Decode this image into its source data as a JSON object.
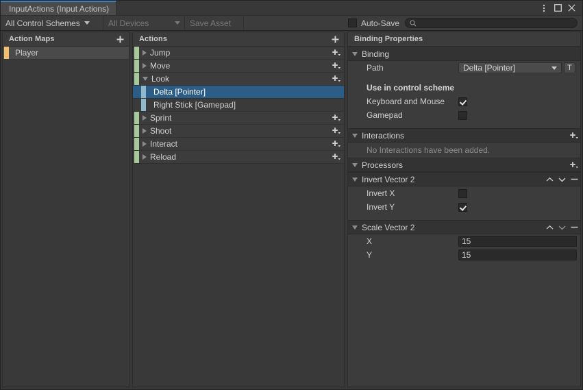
{
  "window": {
    "tab_title": "InputActions (Input Actions)",
    "menu_icon": "kebab-menu-icon",
    "maximize_icon": "maximize-icon",
    "close_icon": "close-icon",
    "accent_color": "#3f7fbe"
  },
  "toolbar": {
    "control_schemes_label": "All Control Schemes",
    "devices_label": "All Devices",
    "save_asset_label": "Save Asset",
    "autosave_label": "Auto-Save",
    "autosave_checked": false,
    "search_icon": "search-icon",
    "search_value": "",
    "search_placeholder": ""
  },
  "action_maps": {
    "header": "Action Maps",
    "add_icon": "plus-icon",
    "items": [
      {
        "label": "Player",
        "selected": true,
        "accent": "#f0c070"
      }
    ]
  },
  "actions": {
    "header": "Actions",
    "add_icon": "plus-icon",
    "accent_action": "#a7c99a",
    "accent_binding": "#8fb8cc",
    "selection_color": "#2c5d87",
    "rows": [
      {
        "type": "action",
        "label": "Jump",
        "expanded": false,
        "selected": false
      },
      {
        "type": "action",
        "label": "Move",
        "expanded": false,
        "selected": false
      },
      {
        "type": "action",
        "label": "Look",
        "expanded": true,
        "selected": false
      },
      {
        "type": "binding",
        "label": "Delta [Pointer]",
        "selected": true
      },
      {
        "type": "binding",
        "label": "Right Stick [Gamepad]",
        "selected": false
      },
      {
        "type": "action",
        "label": "Sprint",
        "expanded": false,
        "selected": false
      },
      {
        "type": "action",
        "label": "Shoot",
        "expanded": false,
        "selected": false
      },
      {
        "type": "action",
        "label": "Interact",
        "expanded": false,
        "selected": false
      },
      {
        "type": "action",
        "label": "Reload",
        "expanded": false,
        "selected": false
      }
    ]
  },
  "binding_properties": {
    "header": "Binding Properties",
    "binding_section": {
      "title": "Binding",
      "expanded": true,
      "path_label": "Path",
      "path_value": "Delta [Pointer]",
      "path_button_label": "T"
    },
    "control_scheme": {
      "title": "Use in control scheme",
      "options": [
        {
          "label": "Keyboard and Mouse",
          "checked": true
        },
        {
          "label": "Gamepad",
          "checked": false
        }
      ]
    },
    "interactions": {
      "title": "Interactions",
      "expanded": true,
      "add_icon": "plus-dropdown-icon",
      "empty_text": "No Interactions have been added."
    },
    "processors": {
      "title": "Processors",
      "expanded": true,
      "add_icon": "plus-dropdown-icon"
    },
    "processor_items": [
      {
        "title": "Invert Vector 2",
        "expanded": true,
        "kind": "checkboxes",
        "fields": [
          {
            "label": "Invert X",
            "checked": false
          },
          {
            "label": "Invert Y",
            "checked": true
          }
        ]
      },
      {
        "title": "Scale Vector 2",
        "expanded": true,
        "kind": "numbers",
        "fields": [
          {
            "label": "X",
            "value": "15"
          },
          {
            "label": "Y",
            "value": "15"
          }
        ]
      }
    ]
  }
}
